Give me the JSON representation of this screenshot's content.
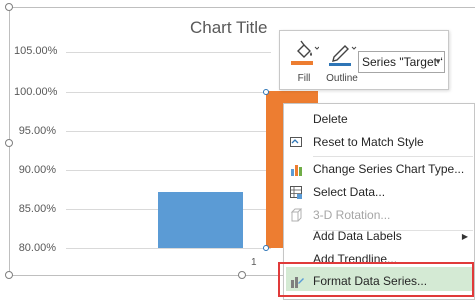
{
  "chart": {
    "title": "Chart Title",
    "y_ticks": [
      "105.00%",
      "100.00%",
      "95.00%",
      "90.00%",
      "85.00%",
      "80.00%"
    ],
    "x_label": "1",
    "colors": {
      "series_blue": "#5b9bd5",
      "series_orange": "#ed7d31",
      "selection": "#2e75b6"
    }
  },
  "chart_data": {
    "type": "bar",
    "categories": [
      "1"
    ],
    "series": [
      {
        "values": [
          0.871
        ]
      },
      {
        "name": "Target",
        "values": [
          1.0
        ]
      }
    ],
    "title": "Chart Title",
    "ylim": [
      0.8,
      1.05
    ],
    "grid": true
  },
  "toolbar": {
    "fill_label": "Fill",
    "outline_label": "Outline",
    "series_select_value": "Series \"Target ‘",
    "fill_icon": "paint-bucket-icon",
    "outline_icon": "pen-outline-icon"
  },
  "menu": {
    "items": [
      {
        "label": "Delete",
        "icon": "",
        "disabled": false
      },
      {
        "label": "Reset to Match Style",
        "icon": "reset-style-icon",
        "disabled": false
      },
      {
        "label": "Change Series Chart Type...",
        "icon": "chart-type-icon",
        "disabled": false
      },
      {
        "label": "Select Data...",
        "icon": "select-data-icon",
        "disabled": false
      },
      {
        "label": "3-D Rotation...",
        "icon": "3d-rotation-icon",
        "disabled": true
      },
      {
        "label": "Add Data Labels",
        "icon": "",
        "disabled": false,
        "has_submenu": true
      },
      {
        "label": "Add Trendline...",
        "icon": "",
        "disabled": false
      },
      {
        "label": "Format Data Series...",
        "icon": "format-series-icon",
        "disabled": false,
        "highlighted": true
      }
    ],
    "highlight_color": "#d4ead4",
    "callout_color": "#e03a3a"
  }
}
